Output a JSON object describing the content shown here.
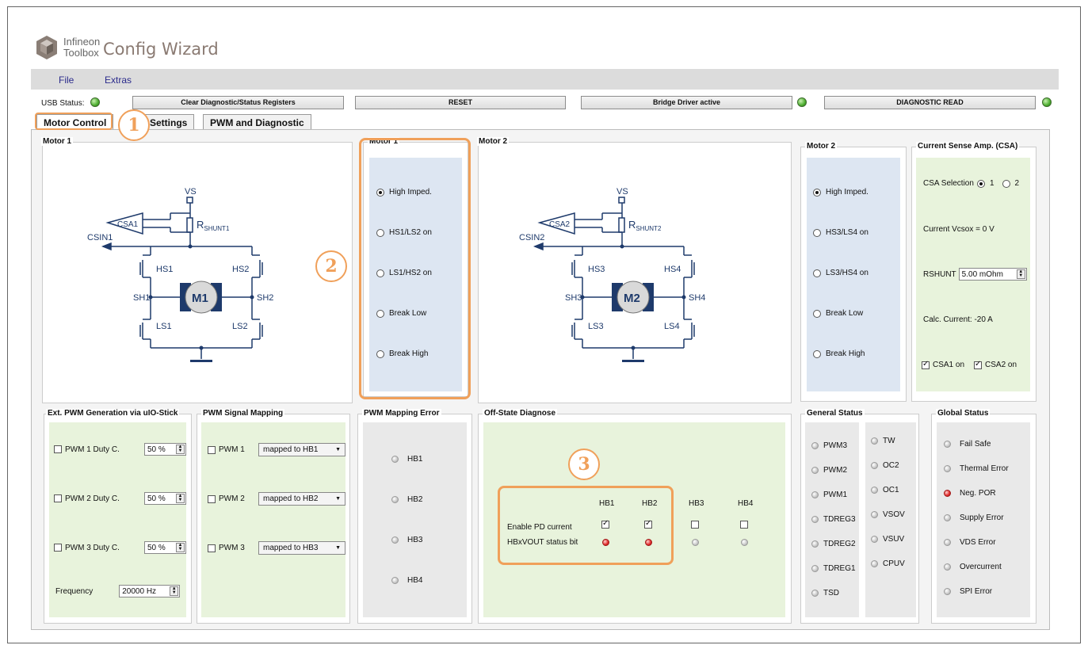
{
  "app": {
    "brand_line1": "Infineon",
    "brand_line2": "Toolbox",
    "title": "Config Wizard"
  },
  "menu": {
    "file": "File",
    "extras": "Extras"
  },
  "statusbar": {
    "usb_label": "USB Status:",
    "clear_label": "Clear Diagnostic/Status Registers",
    "reset_label": "RESET",
    "bridge_label": "Bridge Driver active",
    "diag_read_label": "DIAGNOSTIC READ"
  },
  "tabs": {
    "motor_control": "Motor Control",
    "settings": "Settings",
    "pwm_diag": "PWM and Diagnostic"
  },
  "callouts": {
    "one": "1",
    "two": "2",
    "three": "3"
  },
  "schematic1": {
    "title": "Motor 1",
    "vs": "VS",
    "csa": "CSA1",
    "rshunt": "R",
    "rshunt_sub": "SHUNT1",
    "csin": "CSIN1",
    "hs_left": "HS1",
    "hs_right": "HS2",
    "sh_left": "SH1",
    "sh_right": "SH2",
    "ls_left": "LS1",
    "ls_right": "LS2",
    "motor": "M1"
  },
  "schematic2": {
    "title": "Motor 2",
    "vs": "VS",
    "csa": "CSA2",
    "rshunt": "R",
    "rshunt_sub": "SHUNT2",
    "csin": "CSIN2",
    "hs_left": "HS3",
    "hs_right": "HS4",
    "sh_left": "SH3",
    "sh_right": "SH4",
    "ls_left": "LS3",
    "ls_right": "LS4",
    "motor": "M2"
  },
  "motor1_modes": {
    "title": "Motor 1",
    "options": [
      "High Imped.",
      "HS1/LS2 on",
      "LS1/HS2 on",
      "Break Low",
      "Break High"
    ],
    "selected": 0
  },
  "motor2_modes": {
    "title": "Motor 2",
    "options": [
      "High Imped.",
      "HS3/LS4 on",
      "LS3/HS4 on",
      "Break Low",
      "Break High"
    ],
    "selected": 0
  },
  "csa": {
    "title": "Current Sense Amp. (CSA)",
    "selection_label": "CSA Selection",
    "opt1": "1",
    "opt2": "2",
    "vcsox_label": "Current Vcsox =  0 V",
    "rshunt_label": "RSHUNT",
    "rshunt_value": "5.00 mOhm",
    "calc_label": "Calc. Current:  -20  A",
    "csa1_on": "CSA1 on",
    "csa2_on": "CSA2 on"
  },
  "ext_pwm": {
    "title": "Ext. PWM Generation via uIO-Stick",
    "rows": [
      {
        "label": "PWM 1  Duty C.",
        "value": "50 %"
      },
      {
        "label": "PWM 2  Duty C.",
        "value": "50 %"
      },
      {
        "label": "PWM 3  Duty C.",
        "value": "50 %"
      }
    ],
    "freq_label": "Frequency",
    "freq_value": "20000 Hz"
  },
  "pwm_mapping": {
    "title": "PWM Signal Mapping",
    "rows": [
      {
        "label": "PWM 1",
        "value": "mapped to HB1"
      },
      {
        "label": "PWM 2",
        "value": "mapped to HB2"
      },
      {
        "label": "PWM 3",
        "value": "mapped to HB3"
      }
    ]
  },
  "pwm_error": {
    "title": "PWM Mapping Error",
    "items": [
      "HB1",
      "HB2",
      "HB3",
      "HB4"
    ]
  },
  "offstate": {
    "title": "Off-State Diagnose",
    "headers": [
      "HB1",
      "HB2",
      "HB3",
      "HB4"
    ],
    "enable_label": "Enable PD current",
    "status_label": "HBxVOUT status bit",
    "enable_checked": [
      true,
      true,
      false,
      false
    ],
    "status_active": [
      true,
      true,
      false,
      false
    ]
  },
  "general_status": {
    "title": "General Status",
    "col1": [
      "PWM3",
      "PWM2",
      "PWM1",
      "TDREG3",
      "TDREG2",
      "TDREG1",
      "TSD"
    ],
    "col2": [
      "TW",
      "OC2",
      "OC1",
      "VSOV",
      "VSUV",
      "CPUV"
    ]
  },
  "global_status": {
    "title": "Global Status",
    "items": [
      "Fail Safe",
      "Thermal Error",
      "Neg. POR",
      "Supply Error",
      "VDS Error",
      "Overcurrent",
      "SPI Error"
    ],
    "active_index": 2
  },
  "colors": {
    "accent_orange": "#f0a05a",
    "panel_blue": "#dde6f2",
    "panel_green": "#e8f3dc",
    "led_green": "#4cae2f",
    "led_red": "#e02a2a"
  }
}
